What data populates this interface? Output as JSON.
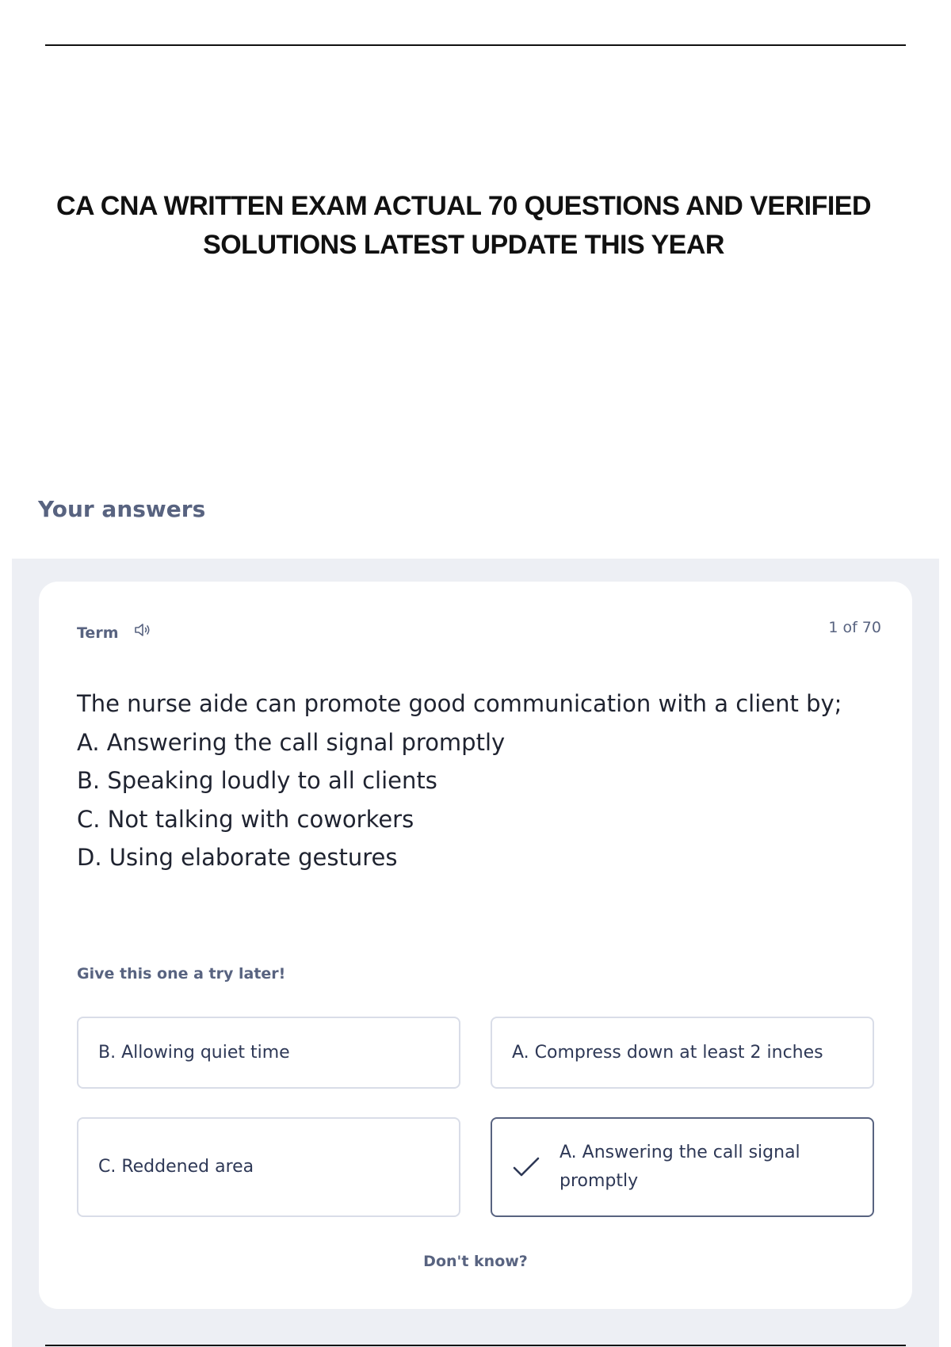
{
  "document": {
    "title": "CA CNA WRITTEN EXAM ACTUAL 70 QUESTIONS AND VERIFIED SOLUTIONS LATEST UPDATE THIS YEAR",
    "section_heading": "Your answers"
  },
  "card": {
    "term_label": "Term",
    "speaker_icon": "speaker-icon",
    "counter": "1 of 70",
    "question_lines": [
      "The nurse aide can promote good communication with a client by;",
      "A. Answering the call signal promptly",
      "B. Speaking loudly to all clients",
      "C. Not talking with coworkers",
      "D. Using elaborate gestures"
    ],
    "hint": "Give this one a try later!",
    "options": [
      {
        "label": "B. Allowing quiet time",
        "selected": false
      },
      {
        "label": "A. Compress down at least 2 inches",
        "selected": false
      },
      {
        "label": "C. Reddened area",
        "selected": false
      },
      {
        "label": "A. Answering the call signal promptly",
        "selected": true,
        "icon": "checkmark-icon"
      }
    ],
    "dont_know": "Don't know?"
  },
  "colors": {
    "muted_text": "#586380",
    "panel_background": "#edeff4",
    "option_border": "#d9dde8",
    "selected_border": "#586380"
  }
}
